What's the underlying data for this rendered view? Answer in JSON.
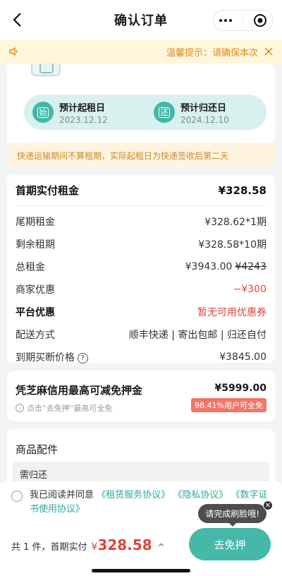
{
  "header": {
    "title": "确认订单"
  },
  "notice": {
    "text": "温馨提示：请确保本次"
  },
  "rental_dates": {
    "start_label": "预计起租日",
    "start_date": "2023.12.12",
    "start_glyph": "始",
    "end_label": "预计归还日",
    "end_date": "2024.12.10",
    "end_glyph": "还"
  },
  "delivery_note": "快递运输期间不算租期，实际起租日为快递签收后第二天",
  "pricing": {
    "first_rent_label": "首期实付租金",
    "first_rent_value": "¥328.58",
    "last_rent_label": "尾期租金",
    "last_rent_value": "¥328.62*1期",
    "remain_label": "剩余租期",
    "remain_value": "¥328.58*10期",
    "total_label": "总租金",
    "total_value": "¥3943.00",
    "total_original": "¥4243",
    "merchant_discount_label": "商家优惠",
    "merchant_discount_value": "−¥300",
    "platform_discount_label": "平台优惠",
    "platform_discount_value": "暂无可用优惠券",
    "shipping_label": "配送方式",
    "shipping_value": "顺丰快递 | 寄出包邮 | 归还自付",
    "buyout_label": "到期买断价格",
    "buyout_value": "¥3845.00",
    "help_glyph": "?"
  },
  "deposit": {
    "title": "凭芝麻信用最高可减免押金",
    "amount": "¥5999.00",
    "tip": "点击“去免押”最高可全免",
    "badge": "98.41%用户可全免",
    "info_glyph": "i"
  },
  "accessories": {
    "title": "商品配件",
    "item": "需归还"
  },
  "agreement": {
    "prefix": "我已阅读并同意",
    "link1": "《租赁服务协议》",
    "link2": "《隐私协议》",
    "link3": "《数字证书使用协议》"
  },
  "tooltip": {
    "text": "请完成刷脸哦!",
    "close": "✕"
  },
  "footer": {
    "summary": "共 1 件，首期实付",
    "currency": "¥",
    "price": "328.58",
    "chevron": "^",
    "cta": "去免押"
  },
  "colors": {
    "accent": "#45b8a9",
    "red": "#e0453a",
    "warning": "#d98b20"
  }
}
